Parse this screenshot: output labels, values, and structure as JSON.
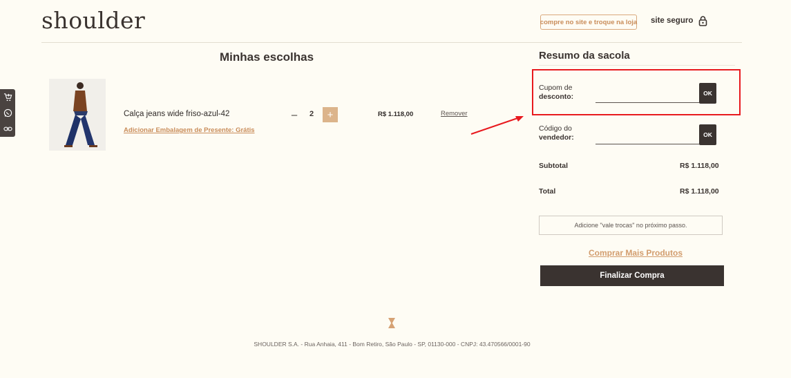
{
  "header": {
    "logo": "shoulder",
    "promo_badge": "compre no site e troque na loja",
    "secure_label": "site seguro"
  },
  "side_tools": [
    "add-to-cart-icon",
    "whatsapp-icon",
    "link-icon"
  ],
  "cart": {
    "title": "Minhas escolhas",
    "item": {
      "name": "Calça jeans wide friso-azul-42",
      "gift_link": "Adicionar Embalagem de Presente: Grátis",
      "minus": "–",
      "quantity": "2",
      "plus": "+",
      "price": "R$ 1.118,00",
      "remove": "Remover"
    }
  },
  "summary": {
    "title": "Resumo da sacola",
    "coupon_label_1": "Cupom de",
    "coupon_label_2": "desconto:",
    "coupon_ok": "OK",
    "seller_label_1": "Código do",
    "seller_label_2": "vendedor:",
    "seller_ok": "OK",
    "subtotal_label": "Subtotal",
    "subtotal_value": "R$ 1.118,00",
    "total_label": "Total",
    "total_value": "R$ 1.118,00",
    "vale_trocas": "Adicione \"vale trocas\" no próximo passo.",
    "more_products": "Comprar Mais Produtos",
    "checkout": "Finalizar Compra"
  },
  "footer": {
    "text": "SHOULDER S.A. - Rua Anhaia, 411 - Bom Retiro, São Paulo - SP, 01130-000 - CNPJ: 43.470566/0001-90"
  },
  "colors": {
    "accent": "#dcb48b",
    "dark": "#3a3330",
    "highlight": "#e8191e",
    "background": "#fefcf4"
  }
}
